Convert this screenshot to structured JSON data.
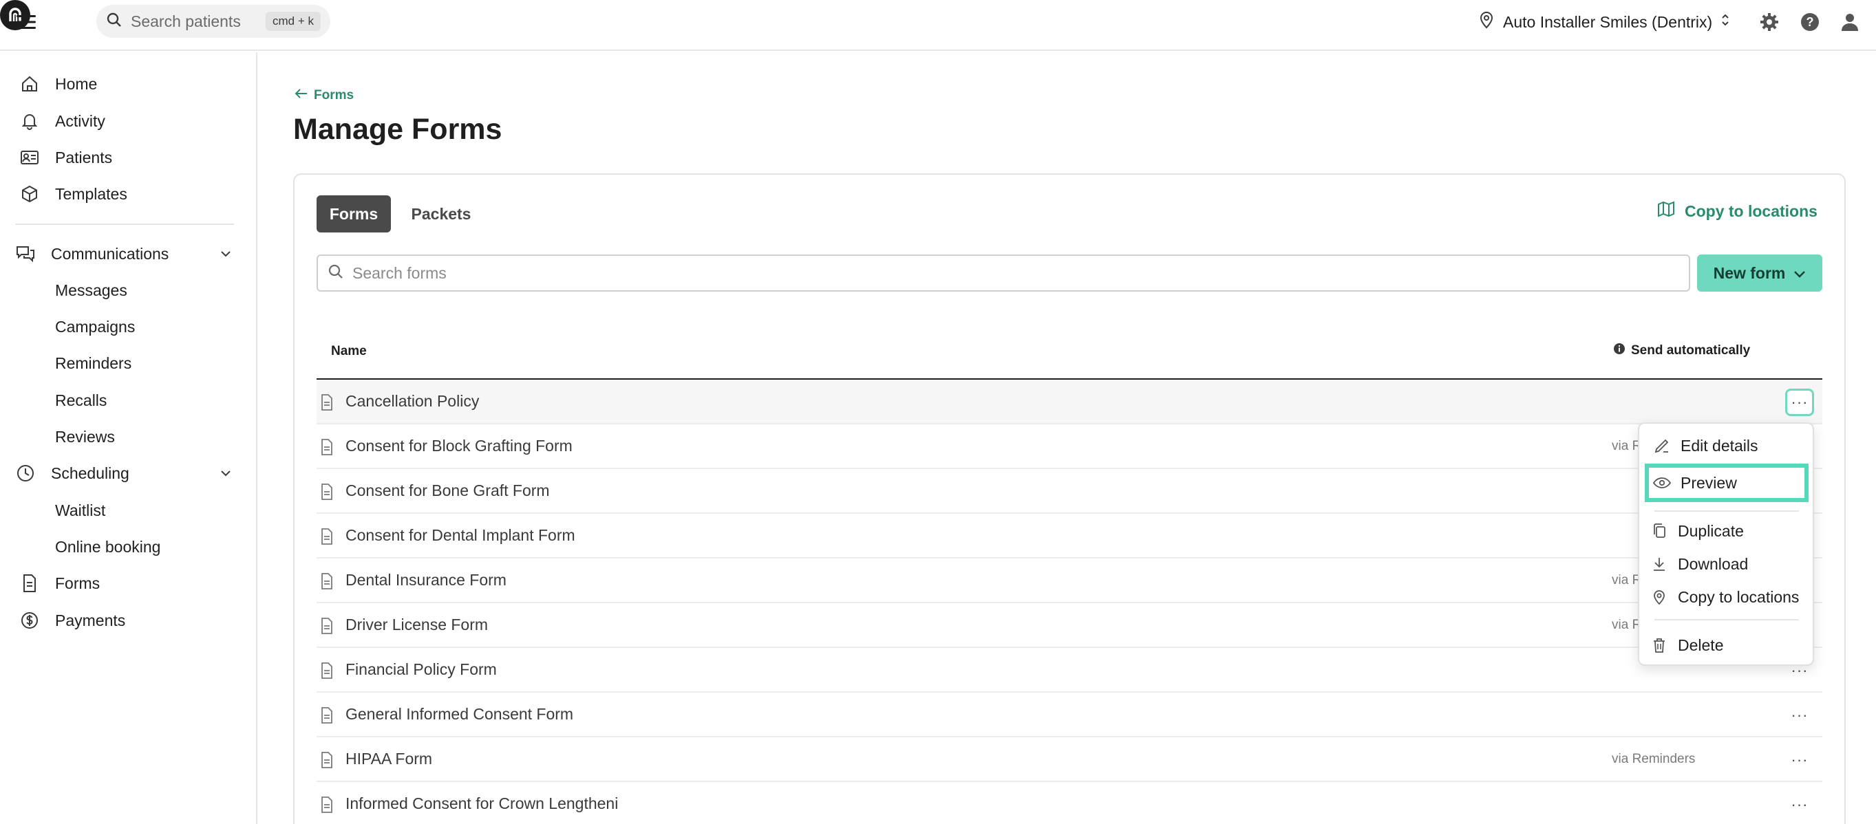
{
  "topbar": {
    "search_placeholder": "Search patients",
    "shortcut": "cmd + k",
    "location": "Auto Installer Smiles (Dentrix)"
  },
  "sidebar": {
    "items": [
      {
        "label": "Home",
        "icon": "home-icon"
      },
      {
        "label": "Activity",
        "icon": "bell-icon"
      },
      {
        "label": "Patients",
        "icon": "id-card-icon"
      },
      {
        "label": "Templates",
        "icon": "cube-icon"
      },
      {
        "label": "Communications",
        "icon": "chat-icon"
      },
      {
        "label": "Messages"
      },
      {
        "label": "Campaigns"
      },
      {
        "label": "Reminders"
      },
      {
        "label": "Recalls"
      },
      {
        "label": "Reviews"
      },
      {
        "label": "Scheduling",
        "icon": "clock-icon"
      },
      {
        "label": "Waitlist"
      },
      {
        "label": "Online booking"
      },
      {
        "label": "Forms",
        "icon": "document-icon"
      },
      {
        "label": "Payments",
        "icon": "dollar-icon"
      }
    ]
  },
  "main": {
    "back_label": "Forms",
    "title": "Manage Forms",
    "tabs": [
      {
        "label": "Forms"
      },
      {
        "label": "Packets"
      }
    ],
    "copy_to_locations": "Copy to locations",
    "search_placeholder": "Search forms",
    "new_form": "New form",
    "columns": {
      "name": "Name",
      "send": "Send automatically"
    },
    "rows": [
      {
        "name": "Cancellation Policy",
        "via": ""
      },
      {
        "name": "Consent for Block Grafting Form",
        "via": "via R"
      },
      {
        "name": "Consent for Bone Graft Form",
        "via": ""
      },
      {
        "name": "Consent for Dental Implant Form",
        "via": ""
      },
      {
        "name": "Dental Insurance Form",
        "via": "via R"
      },
      {
        "name": "Driver License Form",
        "via": "via R"
      },
      {
        "name": "Financial Policy Form",
        "via": ""
      },
      {
        "name": "General Informed Consent Form",
        "via": ""
      },
      {
        "name": "HIPAA Form",
        "via": "via Reminders"
      },
      {
        "name": "Informed Consent for Crown Lengtheni",
        "via": ""
      }
    ],
    "more_glyph": "···"
  },
  "menu": {
    "items": [
      {
        "label": "Edit details",
        "icon": "pencil-icon"
      },
      {
        "label": "Preview",
        "icon": "eye-icon"
      },
      {
        "label": "Duplicate",
        "icon": "copy-icon"
      },
      {
        "label": "Download",
        "icon": "download-icon"
      },
      {
        "label": "Copy to locations",
        "icon": "location-pin-icon"
      },
      {
        "label": "Delete",
        "icon": "trash-icon"
      }
    ]
  },
  "colors": {
    "accent": "#2a8a6e",
    "button": "#6fd9bf",
    "highlight": "#56d9bb"
  }
}
